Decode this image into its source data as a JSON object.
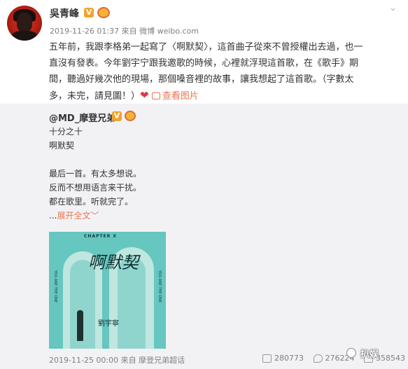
{
  "post": {
    "author": "吳青峰",
    "verified_badge": "V",
    "meta": "2019-11-26 01:37 來自 微博 weibo.com",
    "text_lines": [
      "五年前，我跟李格弟一起寫了〈啊默契〉，這首曲子從來不曾授權出去過，也一",
      "直沒有發表。今年劉宇宁跟我邀歌的時候，心裡就浮現這首歌，在《歌手》期",
      "間，聽過好幾次他的現場，那個嗓音裡的故事，讓我想起了這首歌。（字數太"
    ],
    "last_line_text": "多，未完，請見圖！）",
    "heart": "❤",
    "see_pictures": "查看图片",
    "dropdown_icon": "chevron-down-icon"
  },
  "repost": {
    "author": "@MD_摩登兄弟",
    "verified_badge": "V",
    "lines": [
      "十分之十",
      "啊默契",
      "",
      "最后一首。有太多想说。",
      "反而不想用语言来干扰。",
      "都在歌里。听就完了。"
    ],
    "ellipsis": "...",
    "expand_label": "展开全文",
    "expand_arrow": "﹀",
    "cover": {
      "chapter": "CHAPTER X",
      "title": "啊默契",
      "subtitle": "劉宇寧",
      "side_left": "YOU ARE THE ONE",
      "side_right": "YOU ARE THE ONE"
    },
    "footer": "2019-11-25 00:00 来自 摩登兄弟超话",
    "stats": {
      "repost": "280773",
      "comment": "276224",
      "like": "358543"
    }
  },
  "watermark": "扒娱",
  "colors": {
    "accent": "#eb7350",
    "heart": "#e5344a",
    "badge": "#f2a32f",
    "repost_bg": "#f2f2f5"
  }
}
